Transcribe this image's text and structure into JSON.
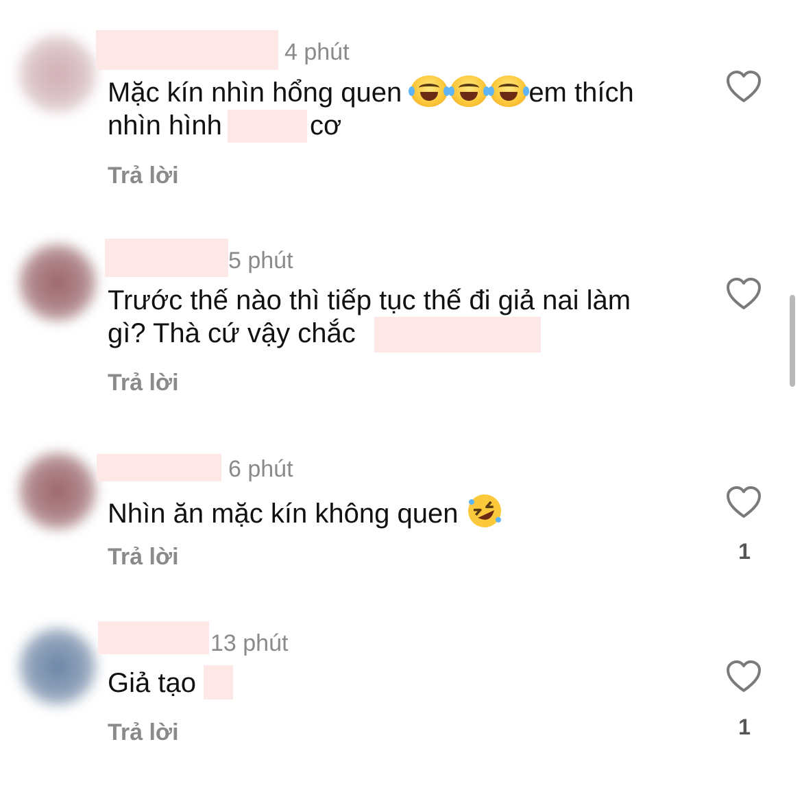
{
  "comments": [
    {
      "time": "4 phút",
      "line1_before": "Mặc kín nhìn hổng quen ",
      "line1_after": "em thích",
      "line2_before": "nhìn hình",
      "line2_after": "cơ",
      "emoji_icon": "face-with-tears-of-joy-icon",
      "reply_label": "Trả lời",
      "likes": ""
    },
    {
      "time": "5 phút",
      "line1": "Trước thế nào thì tiếp tục thế đi giả nai làm",
      "line2": "gì? Thà cứ vậy chắc",
      "reply_label": "Trả lời",
      "likes": ""
    },
    {
      "time": "6 phút",
      "line1": "Nhìn ăn mặc kín không quen ",
      "emoji_icon": "rolling-on-the-floor-laughing-icon",
      "reply_label": "Trả lời",
      "likes": "1"
    },
    {
      "time": "13 phút",
      "line1": "Giả tạo",
      "reply_label": "Trả lời",
      "likes": "1"
    }
  ],
  "colors": {
    "redaction": "#fde7e7",
    "muted_text": "#8a8a8a",
    "body_text": "#111111"
  }
}
